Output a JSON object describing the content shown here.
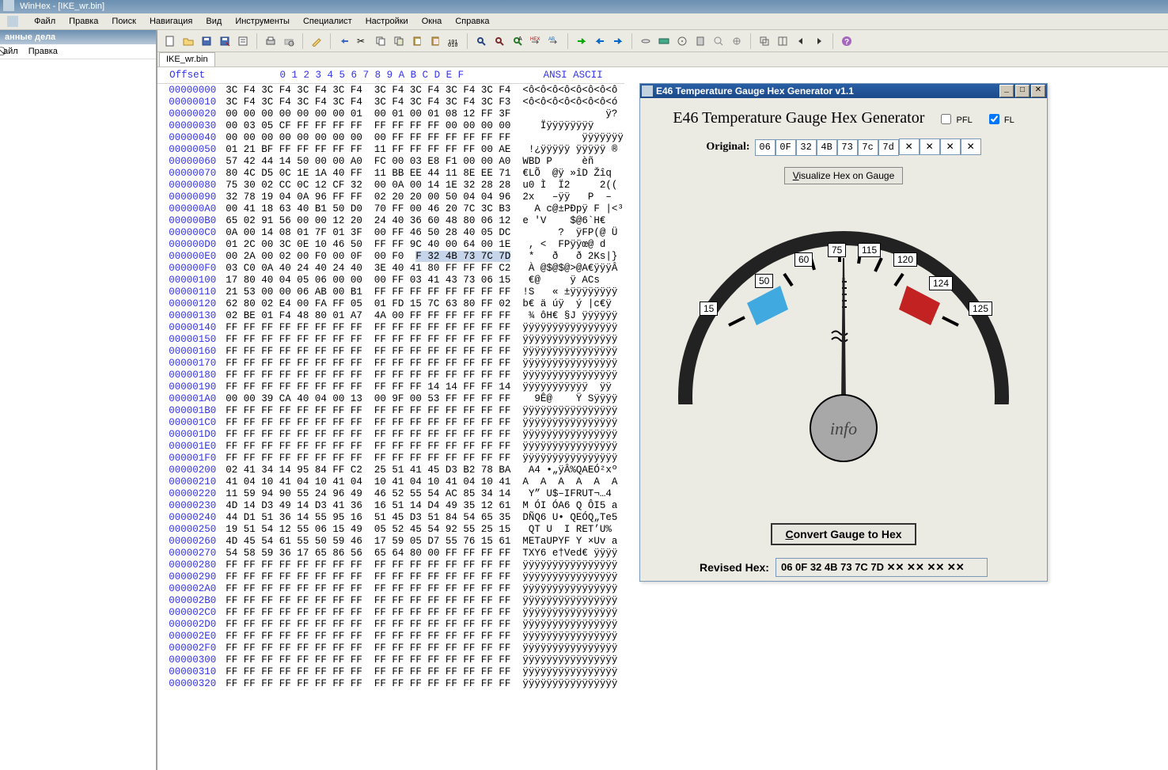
{
  "app": {
    "title": "WinHex - [IKE_wr.bin]"
  },
  "menu": {
    "file": "Файл",
    "edit": "Правка",
    "search": "Поиск",
    "nav": "Навигация",
    "view": "Вид",
    "tools": "Инструменты",
    "spec": "Специалист",
    "opts": "Настройки",
    "win": "Окна",
    "help": "Справка"
  },
  "left": {
    "header": "анные дела",
    "m1": "⃠айл",
    "m2": "Правка"
  },
  "tab": {
    "name": "IKE_wr.bin"
  },
  "hexhdr": {
    "offset": "Offset",
    "cols": [
      "0",
      "1",
      "2",
      "3",
      "4",
      "5",
      "6",
      "7",
      "8",
      "9",
      "A",
      "B",
      "C",
      "D",
      "E",
      "F"
    ],
    "ascii": "ANSI ASCII"
  },
  "rows": [
    {
      "o": "00000000",
      "h": "3C F4 3C F4 3C F4 3C F4  3C F4 3C F4 3C F4 3C F4",
      "a": "<ô<ô<ô<ô<ô<ô<ô<ô"
    },
    {
      "o": "00000010",
      "h": "3C F4 3C F4 3C F4 3C F4  3C F4 3C F4 3C F4 3C F3",
      "a": "<ô<ô<ô<ô<ô<ô<ô<ó"
    },
    {
      "o": "00000020",
      "h": "00 00 00 00 00 00 00 01  00 01 00 01 08 12 FF 3F",
      "a": "              ÿ?"
    },
    {
      "o": "00000030",
      "h": "00 03 05 CF FF FF FF FF  FF FF FF FF 00 00 00 00",
      "a": "   Ïÿÿÿÿÿÿÿÿ    "
    },
    {
      "o": "00000040",
      "h": "00 00 00 00 00 00 00 00  00 FF FF FF FF FF FF FF",
      "a": "          ÿÿÿÿÿÿÿ"
    },
    {
      "o": "00000050",
      "h": "01 21 BF FF FF FF FF FF  11 FF FF FF FF FF 00 AE",
      "a": " !¿ÿÿÿÿÿ ÿÿÿÿÿ ®"
    },
    {
      "o": "00000060",
      "h": "57 42 44 14 50 00 00 A0  FC 00 03 E8 F1 00 00 A0",
      "a": "WBD P     èñ    "
    },
    {
      "o": "00000070",
      "h": "80 4C D5 0C 1E 1A 40 FF  11 BB EE 44 11 8E EE 71",
      "a": "€LÕ  @ÿ »îD Žîq"
    },
    {
      "o": "00000080",
      "h": "75 30 02 CC 0C 12 CF 32  00 0A 00 14 1E 32 28 28",
      "a": "u0 Ì  Ï2     2(("
    },
    {
      "o": "00000090",
      "h": "32 78 19 04 0A 96 FF FF  02 20 20 00 50 04 04 96",
      "a": "2x   –ÿÿ   P  –"
    },
    {
      "o": "000000A0",
      "h": "00 41 18 63 40 B1 50 D0  70 FF 00 46 20 7C 3C B3",
      "a": "  A c@±PÐpÿ F |<³"
    },
    {
      "o": "000000B0",
      "h": "65 02 91 56 00 00 12 20  24 40 36 60 48 80 06 12",
      "a": "e 'V    $@6`H€  "
    },
    {
      "o": "000000C0",
      "h": "0A 00 14 08 01 7F 01 3F  00 FF 46 50 28 40 05 DC",
      "a": "      ?  ÿFP(@ Ü"
    },
    {
      "o": "000000D0",
      "h": "01 2C 00 3C 0E 10 46 50  FF FF 9C 40 00 64 00 1E",
      "a": " , <  FPÿÿœ@ d  "
    },
    {
      "o": "000000E0",
      "h": "00 2A 00 02 00 F0 00 0F  00 F0 0F 32 4B 73 7C 7D",
      "a": " *   ð   ð 2Ks|}"
    },
    {
      "o": "000000F0",
      "h": "03 C0 0A 40 24 40 24 40  3E 40 41 80 FF FF FF C2",
      "a": " À @$@$@>@A€ÿÿÿÂ"
    },
    {
      "o": "00000100",
      "h": "17 80 40 04 05 06 00 00  00 FF 03 41 43 73 06 15",
      "a": " €@     ÿ ACs  "
    },
    {
      "o": "00000110",
      "h": "21 53 00 00 06 AB 00 B1  FF FF FF FF FF FF FF FF",
      "a": "!S   « ±ÿÿÿÿÿÿÿÿ"
    },
    {
      "o": "00000120",
      "h": "62 80 02 E4 00 FA FF 05  01 FD 15 7C 63 80 FF 02",
      "a": "b€ ä úÿ  ý |c€ÿ "
    },
    {
      "o": "00000130",
      "h": "02 BE 01 F4 48 80 01 A7  4A 00 FF FF FF FF FF FF",
      "a": " ¾ ôH€ §J ÿÿÿÿÿÿ"
    },
    {
      "o": "00000140",
      "h": "FF FF FF FF FF FF FF FF  FF FF FF FF FF FF FF FF",
      "a": "ÿÿÿÿÿÿÿÿÿÿÿÿÿÿÿÿ"
    },
    {
      "o": "00000150",
      "h": "FF FF FF FF FF FF FF FF  FF FF FF FF FF FF FF FF",
      "a": "ÿÿÿÿÿÿÿÿÿÿÿÿÿÿÿÿ"
    },
    {
      "o": "00000160",
      "h": "FF FF FF FF FF FF FF FF  FF FF FF FF FF FF FF FF",
      "a": "ÿÿÿÿÿÿÿÿÿÿÿÿÿÿÿÿ"
    },
    {
      "o": "00000170",
      "h": "FF FF FF FF FF FF FF FF  FF FF FF FF FF FF FF FF",
      "a": "ÿÿÿÿÿÿÿÿÿÿÿÿÿÿÿÿ"
    },
    {
      "o": "00000180",
      "h": "FF FF FF FF FF FF FF FF  FF FF FF FF FF FF FF FF",
      "a": "ÿÿÿÿÿÿÿÿÿÿÿÿÿÿÿÿ"
    },
    {
      "o": "00000190",
      "h": "FF FF FF FF FF FF FF FF  FF FF FF 14 14 FF FF 14",
      "a": "ÿÿÿÿÿÿÿÿÿÿÿ  ÿÿ "
    },
    {
      "o": "000001A0",
      "h": "00 00 39 CA 40 04 00 13  00 9F 00 53 FF FF FF FF",
      "a": "  9Ê@    Ÿ Sÿÿÿÿ"
    },
    {
      "o": "000001B0",
      "h": "FF FF FF FF FF FF FF FF  FF FF FF FF FF FF FF FF",
      "a": "ÿÿÿÿÿÿÿÿÿÿÿÿÿÿÿÿ"
    },
    {
      "o": "000001C0",
      "h": "FF FF FF FF FF FF FF FF  FF FF FF FF FF FF FF FF",
      "a": "ÿÿÿÿÿÿÿÿÿÿÿÿÿÿÿÿ"
    },
    {
      "o": "000001D0",
      "h": "FF FF FF FF FF FF FF FF  FF FF FF FF FF FF FF FF",
      "a": "ÿÿÿÿÿÿÿÿÿÿÿÿÿÿÿÿ"
    },
    {
      "o": "000001E0",
      "h": "FF FF FF FF FF FF FF FF  FF FF FF FF FF FF FF FF",
      "a": "ÿÿÿÿÿÿÿÿÿÿÿÿÿÿÿÿ"
    },
    {
      "o": "000001F0",
      "h": "FF FF FF FF FF FF FF FF  FF FF FF FF FF FF FF FF",
      "a": "ÿÿÿÿÿÿÿÿÿÿÿÿÿÿÿÿ"
    },
    {
      "o": "00000200",
      "h": "02 41 34 14 95 84 FF C2  25 51 41 45 D3 B2 78 BA",
      "a": " A4 •„ÿÂ%QAEÓ²xº"
    },
    {
      "o": "00000210",
      "h": "41 04 10 41 04 10 41 04  10 41 04 10 41 04 10 41",
      "a": "A  A  A  A  A  A"
    },
    {
      "o": "00000220",
      "h": "11 59 94 90 55 24 96 49  46 52 55 54 AC 85 34 14",
      "a": " Y” U$–IFRUT¬…4 "
    },
    {
      "o": "00000230",
      "h": "4D 14 D3 49 14 D3 41 36  16 51 14 D4 49 35 12 61",
      "a": "M ÓI ÓA6 Q ÔI5 a"
    },
    {
      "o": "00000240",
      "h": "44 D1 51 36 14 55 95 16  51 45 D3 51 84 54 65 35",
      "a": "DÑQ6 U• QEÓQ„Te5"
    },
    {
      "o": "00000250",
      "h": "19 51 54 12 55 06 15 49  05 52 45 54 92 55 25 15",
      "a": " QT U  I RET’U% "
    },
    {
      "o": "00000260",
      "h": "4D 45 54 61 55 50 59 46  17 59 05 D7 55 76 15 61",
      "a": "MEТaUPYF Y ×Uv a"
    },
    {
      "o": "00000270",
      "h": "54 58 59 36 17 65 86 56  65 64 80 00 FF FF FF FF",
      "a": "TXY6 e†Ved€ ÿÿÿÿ"
    },
    {
      "o": "00000280",
      "h": "FF FF FF FF FF FF FF FF  FF FF FF FF FF FF FF FF",
      "a": "ÿÿÿÿÿÿÿÿÿÿÿÿÿÿÿÿ"
    },
    {
      "o": "00000290",
      "h": "FF FF FF FF FF FF FF FF  FF FF FF FF FF FF FF FF",
      "a": "ÿÿÿÿÿÿÿÿÿÿÿÿÿÿÿÿ"
    },
    {
      "o": "000002A0",
      "h": "FF FF FF FF FF FF FF FF  FF FF FF FF FF FF FF FF",
      "a": "ÿÿÿÿÿÿÿÿÿÿÿÿÿÿÿÿ"
    },
    {
      "o": "000002B0",
      "h": "FF FF FF FF FF FF FF FF  FF FF FF FF FF FF FF FF",
      "a": "ÿÿÿÿÿÿÿÿÿÿÿÿÿÿÿÿ"
    },
    {
      "o": "000002C0",
      "h": "FF FF FF FF FF FF FF FF  FF FF FF FF FF FF FF FF",
      "a": "ÿÿÿÿÿÿÿÿÿÿÿÿÿÿÿÿ"
    },
    {
      "o": "000002D0",
      "h": "FF FF FF FF FF FF FF FF  FF FF FF FF FF FF FF FF",
      "a": "ÿÿÿÿÿÿÿÿÿÿÿÿÿÿÿÿ"
    },
    {
      "o": "000002E0",
      "h": "FF FF FF FF FF FF FF FF  FF FF FF FF FF FF FF FF",
      "a": "ÿÿÿÿÿÿÿÿÿÿÿÿÿÿÿÿ"
    },
    {
      "o": "000002F0",
      "h": "FF FF FF FF FF FF FF FF  FF FF FF FF FF FF FF FF",
      "a": "ÿÿÿÿÿÿÿÿÿÿÿÿÿÿÿÿ"
    },
    {
      "o": "00000300",
      "h": "FF FF FF FF FF FF FF FF  FF FF FF FF FF FF FF FF",
      "a": "ÿÿÿÿÿÿÿÿÿÿÿÿÿÿÿÿ"
    },
    {
      "o": "00000310",
      "h": "FF FF FF FF FF FF FF FF  FF FF FF FF FF FF FF FF",
      "a": "ÿÿÿÿÿÿÿÿÿÿÿÿÿÿÿÿ"
    },
    {
      "o": "00000320",
      "h": "FF FF FF FF FF FF FF FF  FF FF FF FF FF FF FF FF",
      "a": "ÿÿÿÿÿÿÿÿÿÿÿÿÿÿÿÿ"
    }
  ],
  "dlg": {
    "title": "E46 Temperature Gauge Hex Generator v1.1",
    "heading": "E46 Temperature Gauge Hex Generator",
    "pfl": "PFL",
    "fl": "FL",
    "orig_lbl": "Original:",
    "orig": [
      "06",
      "0F",
      "32",
      "4B",
      "73",
      "7c",
      "7d",
      "✕",
      "✕",
      "✕",
      "✕"
    ],
    "viz_btn": "Visualize Hex on Gauge",
    "ticks": {
      "t15": "15",
      "t50": "50",
      "t60": "60",
      "t75": "75",
      "t115": "115",
      "t120": "120",
      "t124": "124",
      "t125": "125"
    },
    "info": "info",
    "convert": "Convert Gauge to Hex",
    "rhex_lbl": "Revised Hex:",
    "rhex_val": "06 0F 32 4B 73 7C 7D ✕✕ ✕✕ ✕✕ ✕✕"
  }
}
